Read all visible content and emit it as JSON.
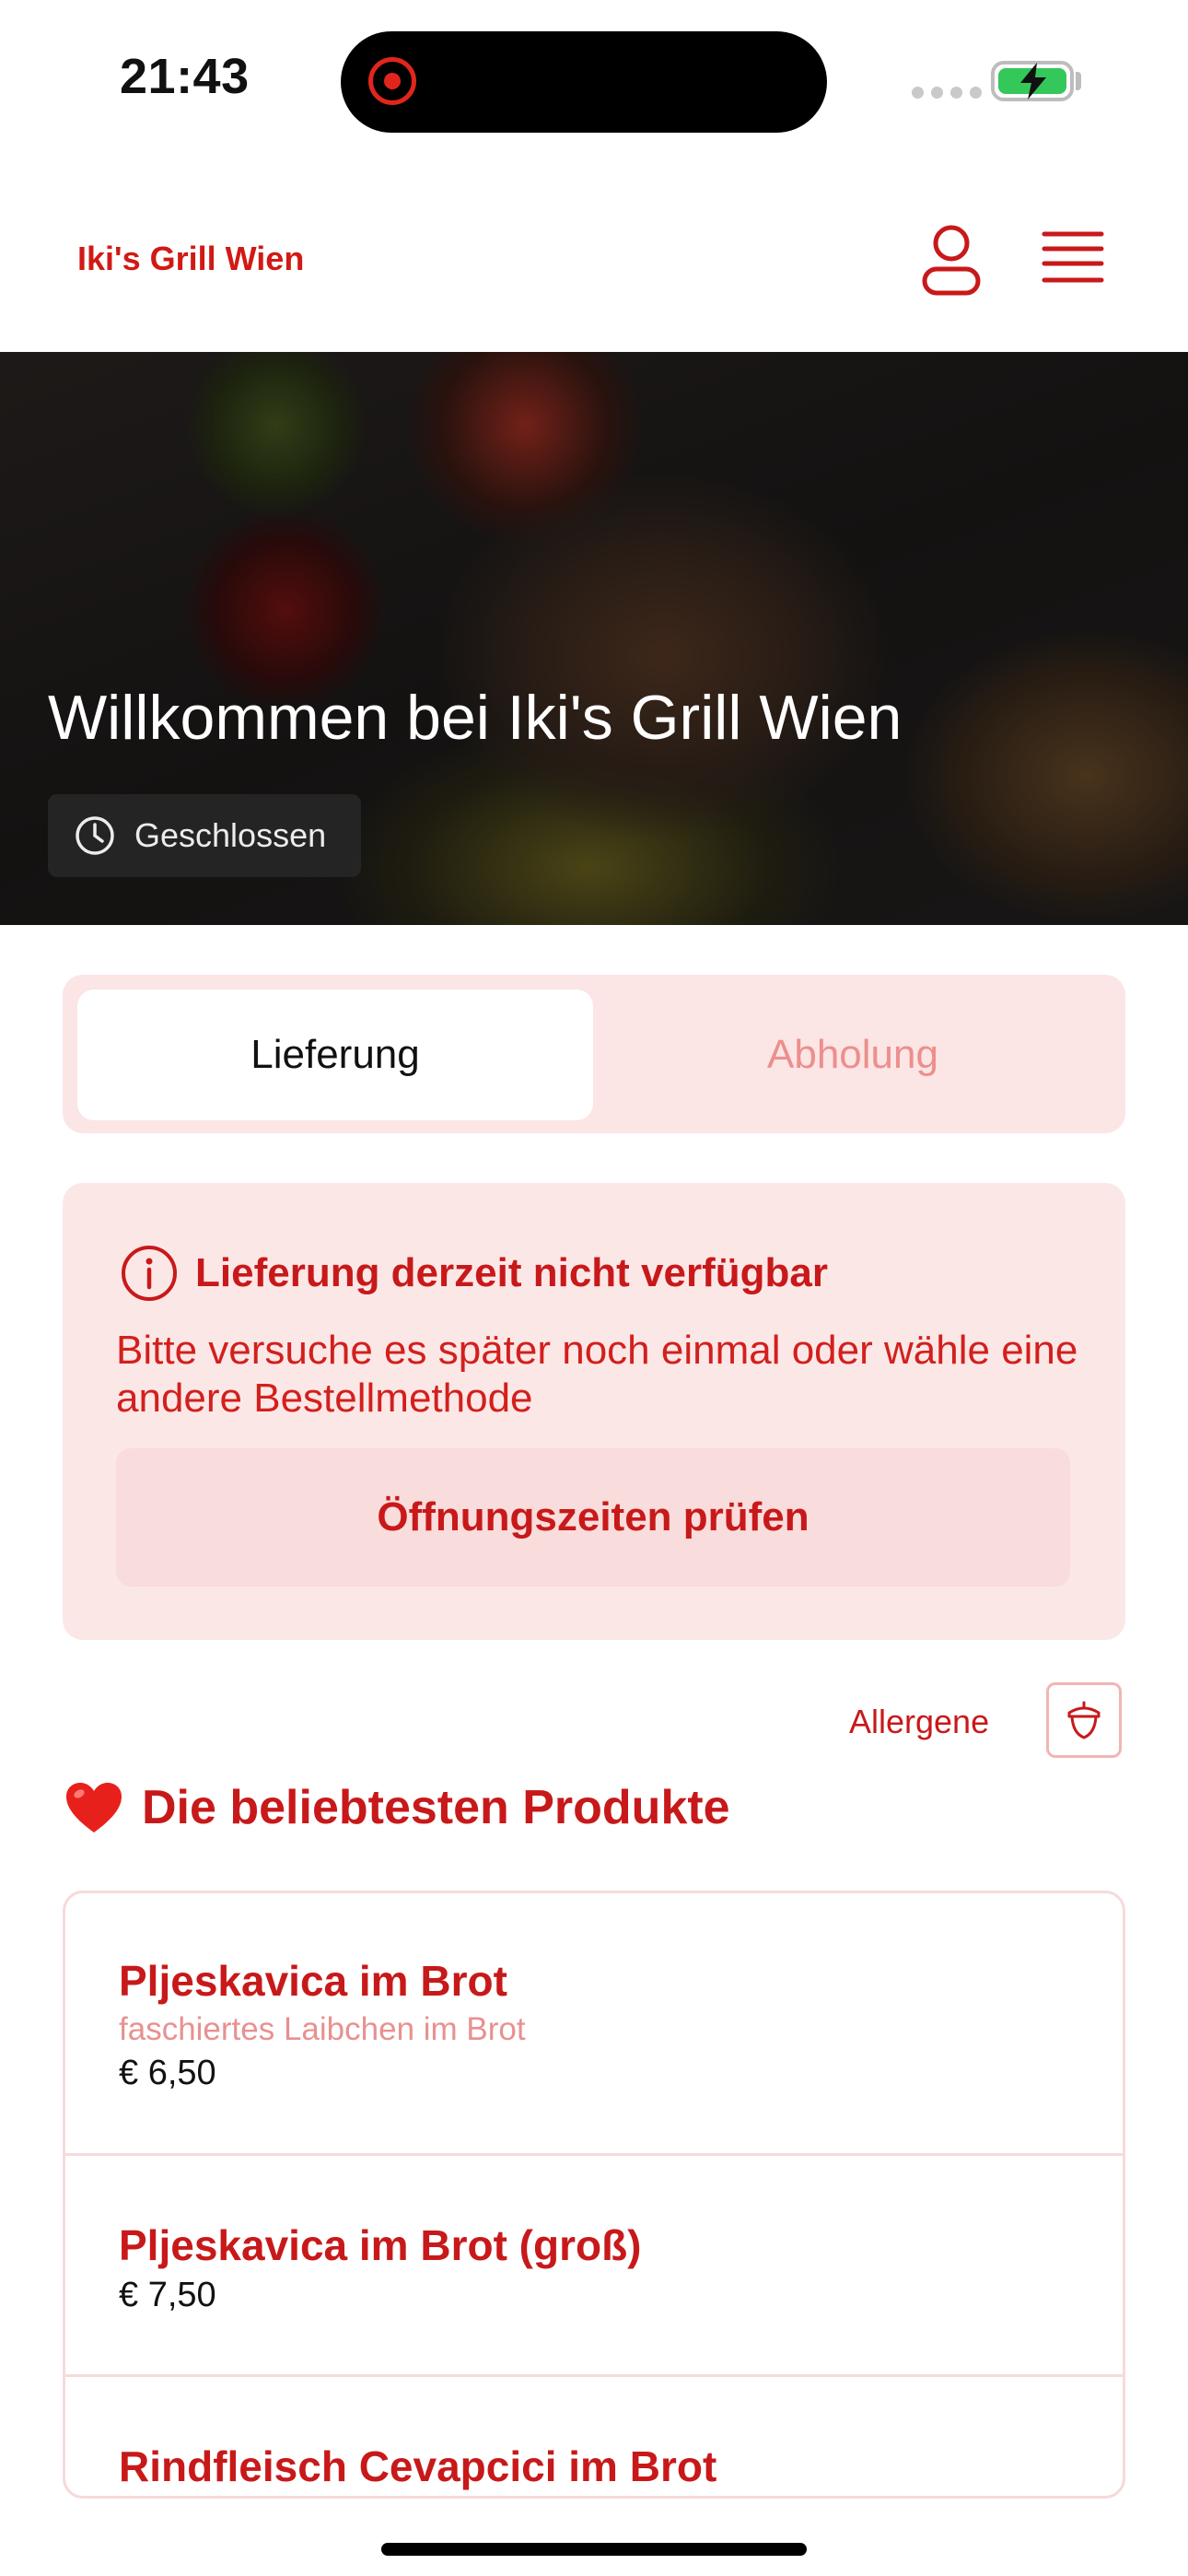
{
  "status_bar": {
    "time": "21:43"
  },
  "header": {
    "brand": "Iki's Grill Wien"
  },
  "hero": {
    "title": "Willkommen bei Iki's Grill Wien",
    "status": "Geschlossen"
  },
  "tabs": [
    {
      "label": "Lieferung",
      "active": true
    },
    {
      "label": "Abholung",
      "active": false
    }
  ],
  "notice": {
    "title": "Lieferung derzeit nicht verfügbar",
    "body": "Bitte versuche es später noch einmal oder wähle eine andere Bestellmethode",
    "button": "Öffnungszeiten prüfen"
  },
  "allergene": {
    "label": "Allergene"
  },
  "section": {
    "title": "Die beliebtesten Produkte",
    "icon": "heart-icon"
  },
  "products": [
    {
      "name": "Pljeskavica im Brot",
      "description": "faschiertes Laibchen im Brot",
      "price": "€ 6,50"
    },
    {
      "name": "Pljeskavica im Brot (groß)",
      "price": "€ 7,50"
    },
    {
      "name": "Rindfleisch Cevapcici im Brot"
    }
  ],
  "colors": {
    "accent": "#c8191a",
    "accent_soft": "#fce7e7",
    "battery": "#34c759"
  }
}
